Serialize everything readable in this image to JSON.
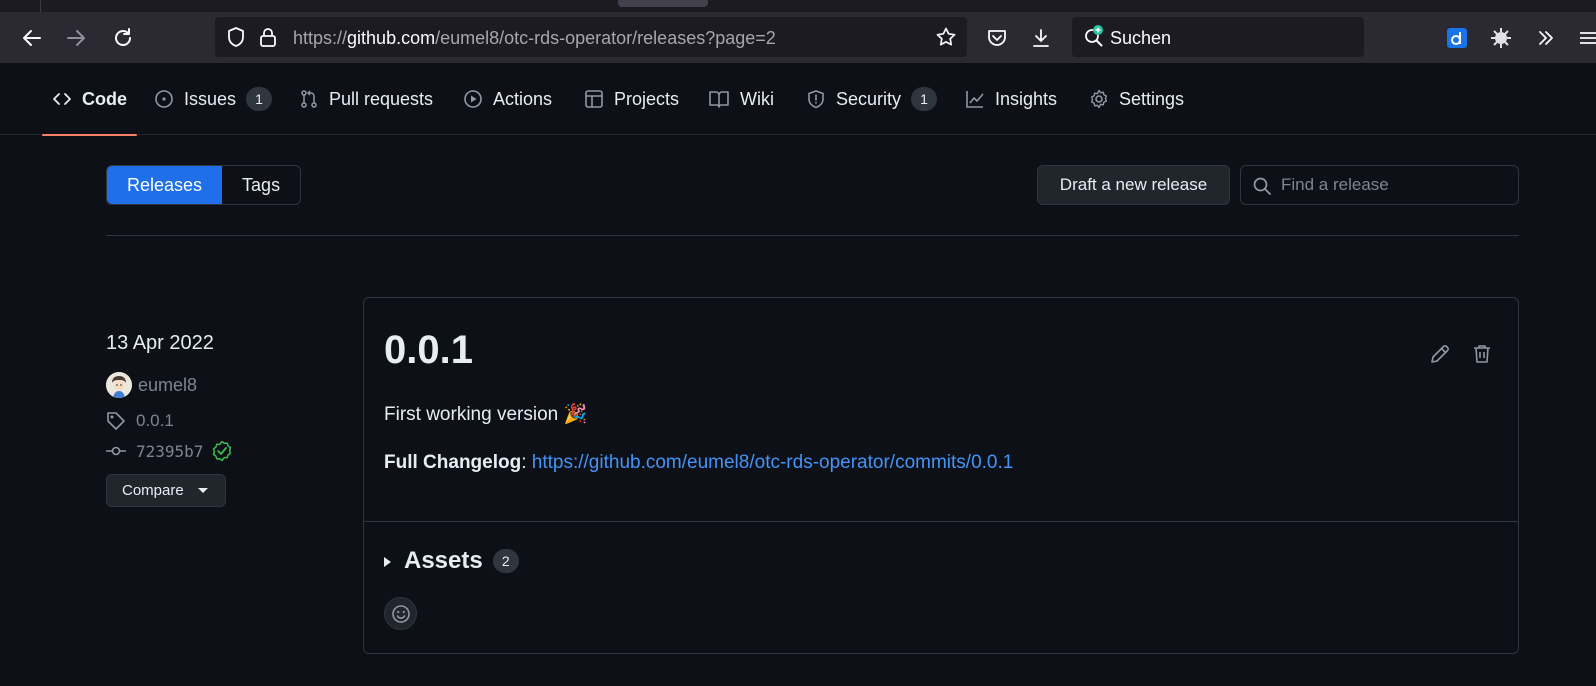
{
  "browser": {
    "url_prefix": "https://",
    "url_host": "github.com",
    "url_path": "/eumel8/otc-rds-operator/releases?page=2",
    "search_placeholder": "Suchen"
  },
  "repo_nav": {
    "code": "Code",
    "issues": "Issues",
    "issues_count": "1",
    "pull_requests": "Pull requests",
    "actions": "Actions",
    "projects": "Projects",
    "wiki": "Wiki",
    "security": "Security",
    "security_count": "1",
    "insights": "Insights",
    "settings": "Settings"
  },
  "subnav": {
    "releases": "Releases",
    "tags": "Tags",
    "draft_button": "Draft a new release",
    "find_placeholder": "Find a release"
  },
  "release": {
    "date": "13 Apr 2022",
    "author": "eumel8",
    "tag": "0.0.1",
    "commit": "72395b7",
    "compare": "Compare",
    "title": "0.0.1",
    "body": "First working version 🎉",
    "changelog_label": "Full Changelog",
    "changelog_colon": ":",
    "changelog_url": "https://github.com/eumel8/otc-rds-operator/commits/0.0.1",
    "assets_label": "Assets",
    "assets_count": "2"
  },
  "colors": {
    "background": "#0d1117",
    "accent_blue": "#1f6feb",
    "link": "#4493f8",
    "active_underline": "#f78166",
    "verified_green": "#3fb950"
  },
  "icons": [
    "back-arrow-icon",
    "forward-arrow-icon",
    "reload-icon",
    "shield-icon",
    "lock-icon",
    "star-icon",
    "pocket-icon",
    "download-icon",
    "search-icon",
    "extension-icon",
    "overflow-icon",
    "code-icon",
    "issue-icon",
    "pull-request-icon",
    "play-icon",
    "table-icon",
    "book-icon",
    "security-shield-icon",
    "graph-icon",
    "gear-icon",
    "tag-icon",
    "commit-icon",
    "verified-check-icon",
    "pencil-icon",
    "trash-icon",
    "smiley-icon"
  ]
}
